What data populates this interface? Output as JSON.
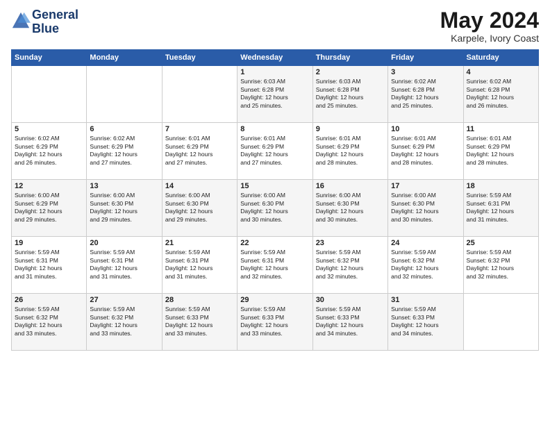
{
  "logo": {
    "line1": "General",
    "line2": "Blue"
  },
  "title": "May 2024",
  "location": "Karpele, Ivory Coast",
  "days_header": [
    "Sunday",
    "Monday",
    "Tuesday",
    "Wednesday",
    "Thursday",
    "Friday",
    "Saturday"
  ],
  "weeks": [
    [
      {
        "day": "",
        "info": ""
      },
      {
        "day": "",
        "info": ""
      },
      {
        "day": "",
        "info": ""
      },
      {
        "day": "1",
        "info": "Sunrise: 6:03 AM\nSunset: 6:28 PM\nDaylight: 12 hours\nand 25 minutes."
      },
      {
        "day": "2",
        "info": "Sunrise: 6:03 AM\nSunset: 6:28 PM\nDaylight: 12 hours\nand 25 minutes."
      },
      {
        "day": "3",
        "info": "Sunrise: 6:02 AM\nSunset: 6:28 PM\nDaylight: 12 hours\nand 25 minutes."
      },
      {
        "day": "4",
        "info": "Sunrise: 6:02 AM\nSunset: 6:28 PM\nDaylight: 12 hours\nand 26 minutes."
      }
    ],
    [
      {
        "day": "5",
        "info": "Sunrise: 6:02 AM\nSunset: 6:29 PM\nDaylight: 12 hours\nand 26 minutes."
      },
      {
        "day": "6",
        "info": "Sunrise: 6:02 AM\nSunset: 6:29 PM\nDaylight: 12 hours\nand 27 minutes."
      },
      {
        "day": "7",
        "info": "Sunrise: 6:01 AM\nSunset: 6:29 PM\nDaylight: 12 hours\nand 27 minutes."
      },
      {
        "day": "8",
        "info": "Sunrise: 6:01 AM\nSunset: 6:29 PM\nDaylight: 12 hours\nand 27 minutes."
      },
      {
        "day": "9",
        "info": "Sunrise: 6:01 AM\nSunset: 6:29 PM\nDaylight: 12 hours\nand 28 minutes."
      },
      {
        "day": "10",
        "info": "Sunrise: 6:01 AM\nSunset: 6:29 PM\nDaylight: 12 hours\nand 28 minutes."
      },
      {
        "day": "11",
        "info": "Sunrise: 6:01 AM\nSunset: 6:29 PM\nDaylight: 12 hours\nand 28 minutes."
      }
    ],
    [
      {
        "day": "12",
        "info": "Sunrise: 6:00 AM\nSunset: 6:29 PM\nDaylight: 12 hours\nand 29 minutes."
      },
      {
        "day": "13",
        "info": "Sunrise: 6:00 AM\nSunset: 6:30 PM\nDaylight: 12 hours\nand 29 minutes."
      },
      {
        "day": "14",
        "info": "Sunrise: 6:00 AM\nSunset: 6:30 PM\nDaylight: 12 hours\nand 29 minutes."
      },
      {
        "day": "15",
        "info": "Sunrise: 6:00 AM\nSunset: 6:30 PM\nDaylight: 12 hours\nand 30 minutes."
      },
      {
        "day": "16",
        "info": "Sunrise: 6:00 AM\nSunset: 6:30 PM\nDaylight: 12 hours\nand 30 minutes."
      },
      {
        "day": "17",
        "info": "Sunrise: 6:00 AM\nSunset: 6:30 PM\nDaylight: 12 hours\nand 30 minutes."
      },
      {
        "day": "18",
        "info": "Sunrise: 5:59 AM\nSunset: 6:31 PM\nDaylight: 12 hours\nand 31 minutes."
      }
    ],
    [
      {
        "day": "19",
        "info": "Sunrise: 5:59 AM\nSunset: 6:31 PM\nDaylight: 12 hours\nand 31 minutes."
      },
      {
        "day": "20",
        "info": "Sunrise: 5:59 AM\nSunset: 6:31 PM\nDaylight: 12 hours\nand 31 minutes."
      },
      {
        "day": "21",
        "info": "Sunrise: 5:59 AM\nSunset: 6:31 PM\nDaylight: 12 hours\nand 31 minutes."
      },
      {
        "day": "22",
        "info": "Sunrise: 5:59 AM\nSunset: 6:31 PM\nDaylight: 12 hours\nand 32 minutes."
      },
      {
        "day": "23",
        "info": "Sunrise: 5:59 AM\nSunset: 6:32 PM\nDaylight: 12 hours\nand 32 minutes."
      },
      {
        "day": "24",
        "info": "Sunrise: 5:59 AM\nSunset: 6:32 PM\nDaylight: 12 hours\nand 32 minutes."
      },
      {
        "day": "25",
        "info": "Sunrise: 5:59 AM\nSunset: 6:32 PM\nDaylight: 12 hours\nand 32 minutes."
      }
    ],
    [
      {
        "day": "26",
        "info": "Sunrise: 5:59 AM\nSunset: 6:32 PM\nDaylight: 12 hours\nand 33 minutes."
      },
      {
        "day": "27",
        "info": "Sunrise: 5:59 AM\nSunset: 6:32 PM\nDaylight: 12 hours\nand 33 minutes."
      },
      {
        "day": "28",
        "info": "Sunrise: 5:59 AM\nSunset: 6:33 PM\nDaylight: 12 hours\nand 33 minutes."
      },
      {
        "day": "29",
        "info": "Sunrise: 5:59 AM\nSunset: 6:33 PM\nDaylight: 12 hours\nand 33 minutes."
      },
      {
        "day": "30",
        "info": "Sunrise: 5:59 AM\nSunset: 6:33 PM\nDaylight: 12 hours\nand 34 minutes."
      },
      {
        "day": "31",
        "info": "Sunrise: 5:59 AM\nSunset: 6:33 PM\nDaylight: 12 hours\nand 34 minutes."
      },
      {
        "day": "",
        "info": ""
      }
    ]
  ]
}
